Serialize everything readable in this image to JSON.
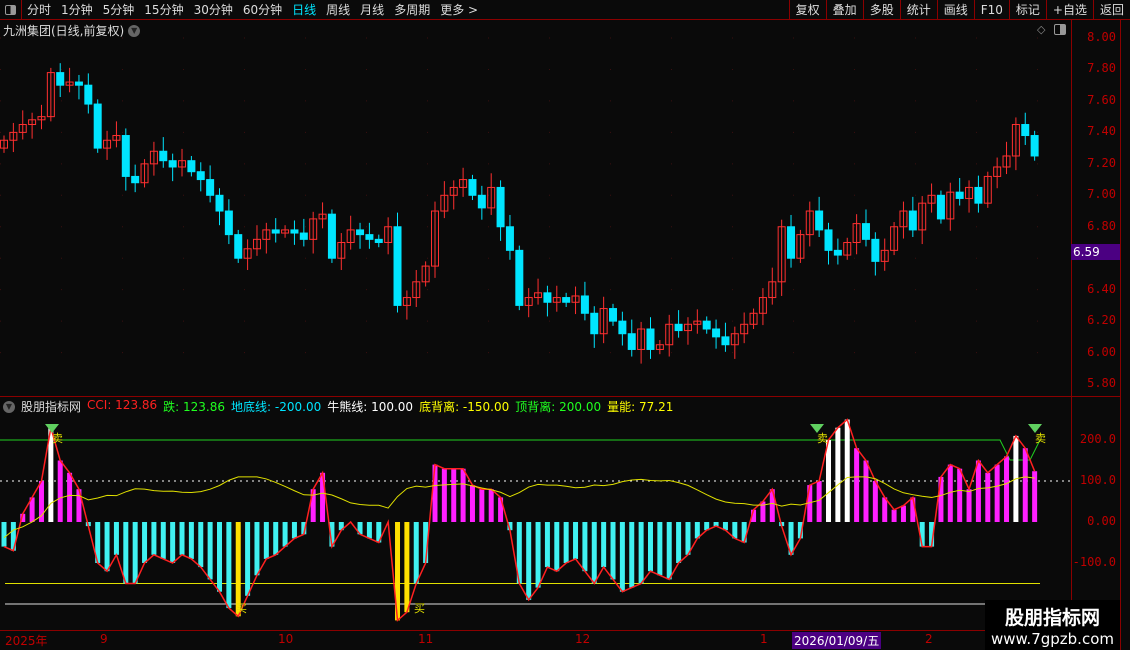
{
  "toolbar": {
    "periods": [
      "分时",
      "1分钟",
      "5分钟",
      "15分钟",
      "30分钟",
      "60分钟",
      "日线",
      "周线",
      "月线",
      "多周期",
      "更多 >"
    ],
    "active": "日线",
    "right_buttons": [
      "复权",
      "叠加",
      "多股",
      "统计",
      "画线",
      "F10",
      "标记",
      "+自选",
      "返回"
    ]
  },
  "chart_title": "九洲集团(日线,前复权)",
  "price_axis": [
    "8.00",
    "7.80",
    "7.60",
    "7.40",
    "7.20",
    "7.00",
    "6.80",
    "6.40",
    "6.20",
    "6.00",
    "5.80"
  ],
  "current_price": "6.59",
  "indicator": {
    "name": "股朋指标网",
    "items": [
      {
        "label": "CCI: 123.86",
        "color": "#ff2020"
      },
      {
        "label": "跌: 123.86",
        "color": "#20ff20"
      },
      {
        "label": "地底线: -200.00",
        "color": "#00e5ff"
      },
      {
        "label": "牛熊线: 100.00",
        "color": "#ffffff"
      },
      {
        "label": "底背离: -150.00",
        "color": "#ffff00"
      },
      {
        "label": "顶背离: 200.00",
        "color": "#20ff20"
      },
      {
        "label": "量能: 77.21",
        "color": "#ffff00"
      }
    ],
    "axis": [
      "200.0",
      "100.0",
      "0.00",
      "-100.0"
    ],
    "sell_label": "卖",
    "buy_label": "买"
  },
  "dates": {
    "labels": [
      "2025年",
      "9",
      "10",
      "11",
      "12",
      "1",
      "2"
    ],
    "highlight": "2026/01/09/五"
  },
  "watermark": {
    "title": "股朋指标网",
    "url": "www.7gpzb.com"
  },
  "chart_data": {
    "type": "candlestick",
    "closes": [
      7.35,
      7.4,
      7.45,
      7.48,
      7.5,
      7.78,
      7.7,
      7.72,
      7.7,
      7.58,
      7.3,
      7.35,
      7.38,
      7.12,
      7.08,
      7.2,
      7.28,
      7.22,
      7.18,
      7.22,
      7.15,
      7.1,
      7.0,
      6.9,
      6.75,
      6.6,
      6.66,
      6.72,
      6.78,
      6.76,
      6.78,
      6.76,
      6.72,
      6.85,
      6.88,
      6.6,
      6.7,
      6.78,
      6.75,
      6.72,
      6.7,
      6.8,
      6.3,
      6.35,
      6.45,
      6.55,
      6.9,
      7.0,
      7.05,
      7.1,
      7.0,
      6.92,
      7.05,
      6.8,
      6.65,
      6.3,
      6.35,
      6.38,
      6.32,
      6.35,
      6.32,
      6.36,
      6.25,
      6.12,
      6.28,
      6.2,
      6.12,
      6.02,
      6.15,
      6.02,
      6.05,
      6.18,
      6.14,
      6.18,
      6.2,
      6.15,
      6.1,
      6.05,
      6.12,
      6.18,
      6.25,
      6.35,
      6.45,
      6.8,
      6.6,
      6.75,
      6.9,
      6.78,
      6.65,
      6.62,
      6.7,
      6.82,
      6.72,
      6.58,
      6.65,
      6.8,
      6.9,
      6.78,
      6.95,
      7.0,
      6.85,
      7.02,
      6.98,
      7.05,
      6.95,
      7.12,
      7.18,
      7.25,
      7.45,
      7.38,
      7.25
    ],
    "cci": [
      -60,
      -70,
      20,
      60,
      100,
      230,
      150,
      120,
      80,
      -10,
      -100,
      -120,
      -80,
      -150,
      -150,
      -100,
      -80,
      -90,
      -100,
      -80,
      -90,
      -110,
      -140,
      -170,
      -210,
      -230,
      -180,
      -130,
      -90,
      -80,
      -60,
      -40,
      -30,
      80,
      120,
      -60,
      -20,
      0,
      -30,
      -40,
      -50,
      0,
      -240,
      -220,
      -150,
      -100,
      140,
      130,
      130,
      130,
      90,
      80,
      80,
      60,
      -20,
      -150,
      -190,
      -160,
      -110,
      -120,
      -100,
      -90,
      -120,
      -150,
      -110,
      -140,
      -170,
      -160,
      -150,
      -120,
      -130,
      -140,
      -100,
      -80,
      -40,
      -20,
      -10,
      -20,
      -40,
      -50,
      30,
      50,
      80,
      -10,
      -80,
      -40,
      90,
      100,
      200,
      230,
      250,
      180,
      150,
      100,
      60,
      30,
      40,
      60,
      -60,
      -60,
      110,
      140,
      130,
      80,
      150,
      120,
      140,
      160,
      210,
      180,
      123.86
    ],
    "price_range": [
      5.8,
      8.0
    ],
    "cci_range": [
      -250,
      260
    ]
  }
}
